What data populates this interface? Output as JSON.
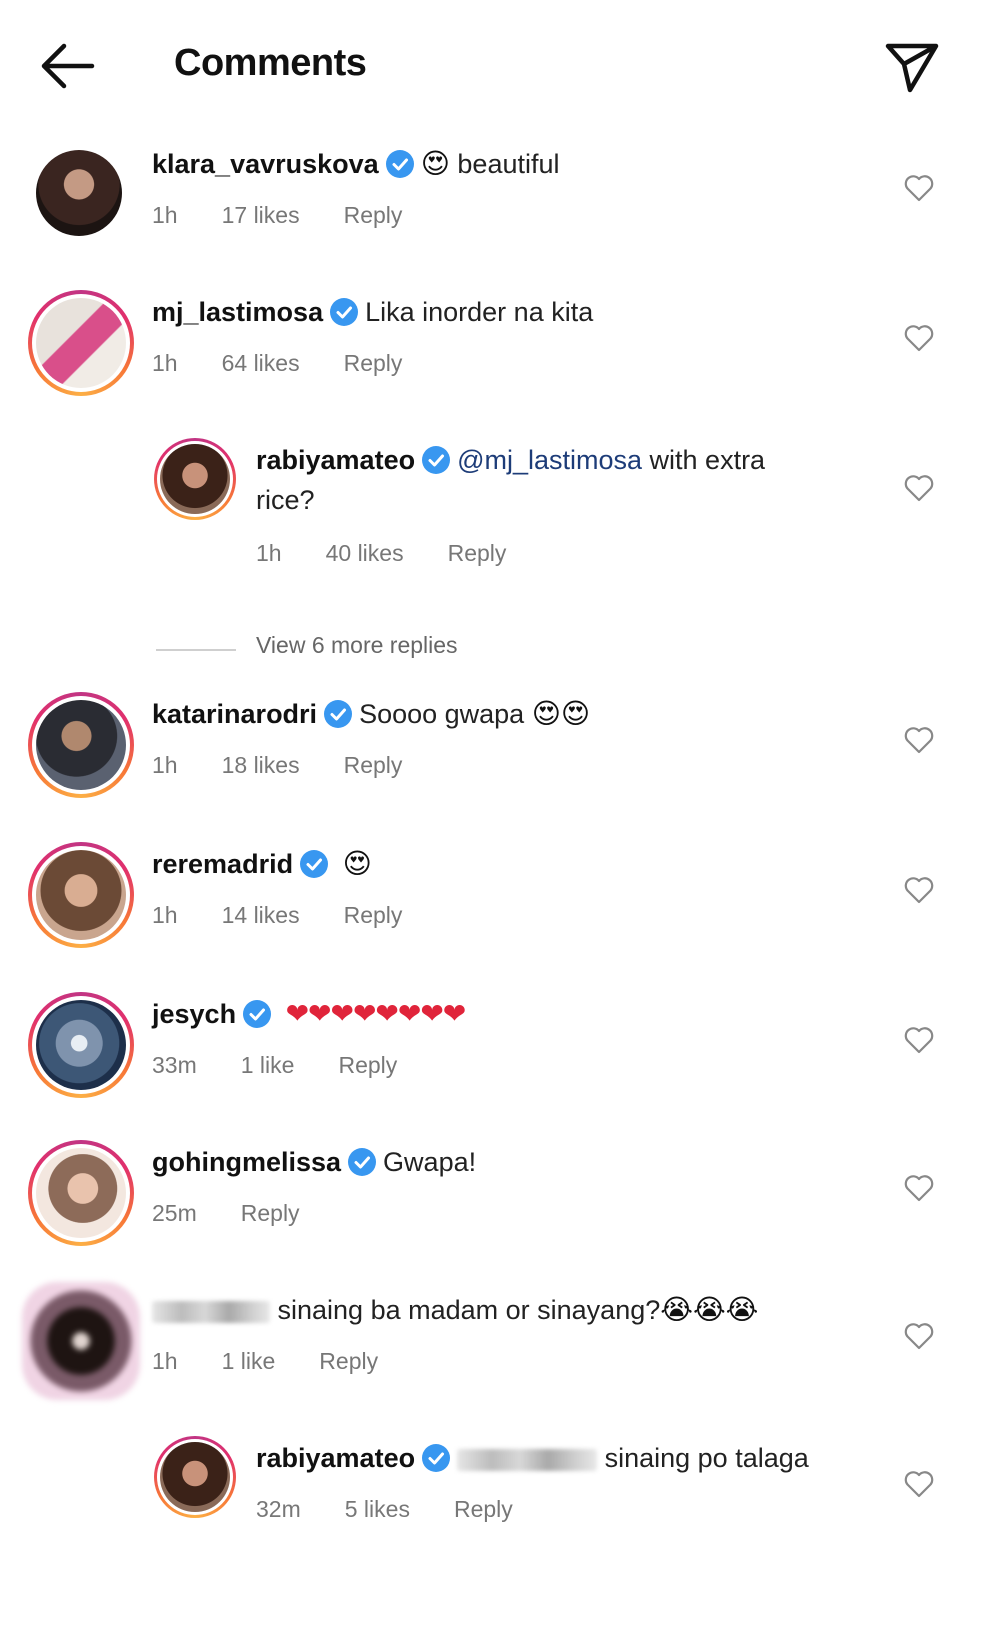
{
  "header": {
    "title": "Comments",
    "back_icon": "arrow-left-icon",
    "share_icon": "paper-plane-icon"
  },
  "colors": {
    "verified": "#3897f0",
    "link": "#1d3c78",
    "meta": "#777777",
    "story_ring": [
      "#c13584",
      "#e1306c",
      "#f77737",
      "#fcaf45"
    ]
  },
  "comments": [
    {
      "username": "klara_vavruskova",
      "verified": true,
      "text": "beautiful",
      "emoji_before": "😍",
      "time": "1h",
      "likes": "17 likes",
      "reply": "Reply"
    },
    {
      "username": "mj_lastimosa",
      "verified": true,
      "text": "Lika inorder na kita",
      "time": "1h",
      "likes": "64 likes",
      "reply": "Reply"
    },
    {
      "username": "rabiyamateo",
      "verified": true,
      "mention": "@mj_lastimosa",
      "text": " with extra",
      "text_line2": "rice?",
      "time": "1h",
      "likes": "40 likes",
      "reply": "Reply"
    },
    {
      "username": "katarinarodri",
      "verified": true,
      "text": "Soooo gwapa",
      "emoji_after": "😍😍",
      "time": "1h",
      "likes": "18 likes",
      "reply": "Reply"
    },
    {
      "username": "reremadrid",
      "verified": true,
      "emoji_after": "😍",
      "time": "1h",
      "likes": "14 likes",
      "reply": "Reply"
    },
    {
      "username": "jesych",
      "verified": true,
      "emoji_after": "❤❤❤❤❤❤❤❤",
      "time": "33m",
      "likes": "1 like",
      "reply": "Reply"
    },
    {
      "username": "gohingmelissa",
      "verified": true,
      "text": "Gwapa!",
      "time": "25m",
      "reply": "Reply"
    },
    {
      "username_redacted": true,
      "text": "sinaing ba madam or sinayang?",
      "emoji_after": "😭😭😭",
      "time": "1h",
      "likes": "1 like",
      "reply": "Reply"
    },
    {
      "username": "rabiyamateo",
      "verified": true,
      "mention_redacted": true,
      "text": "sinaing po talaga",
      "time": "32m",
      "likes": "5 likes",
      "reply": "Reply"
    }
  ],
  "view_more_replies": "View 6 more replies"
}
